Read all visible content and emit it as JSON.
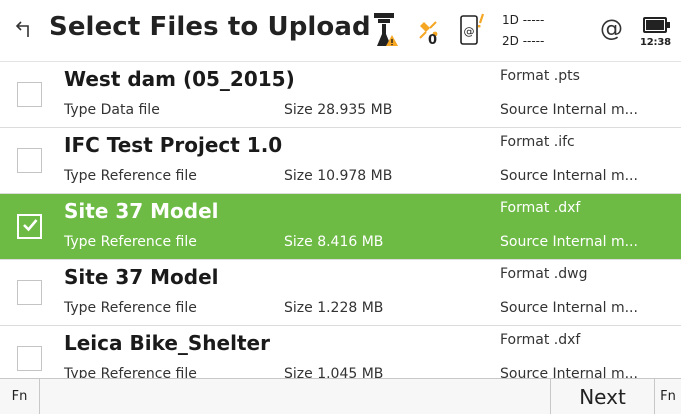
{
  "header": {
    "back_icon": "back-arrow-icon",
    "title": "Select Files to Upload",
    "satellite_count": "0",
    "quality": {
      "line1": "1D -----",
      "line2": "2D -----"
    },
    "internet_symbol": "@",
    "battery_time": "12:38",
    "colors": {
      "warning": "#f5a623",
      "battery": "#222222"
    }
  },
  "files": [
    {
      "name": "West dam (05_2015)",
      "type": "Type  Data file",
      "size": "Size  28.935 MB",
      "format": "Format  .pts",
      "source": "Source  Internal m...",
      "checked": false
    },
    {
      "name": "IFC Test Project 1.0",
      "type": "Type  Reference file",
      "size": "Size  10.978 MB",
      "format": "Format  .ifc",
      "source": "Source  Internal m...",
      "checked": false
    },
    {
      "name": "Site 37 Model",
      "type": "Type  Reference file",
      "size": "Size  8.416 MB",
      "format": "Format  .dxf",
      "source": "Source  Internal m...",
      "checked": true
    },
    {
      "name": "Site 37 Model",
      "type": "Type  Reference file",
      "size": "Size  1.228 MB",
      "format": "Format  .dwg",
      "source": "Source  Internal m...",
      "checked": false
    },
    {
      "name": "Leica Bike_Shelter",
      "type": "Type  Reference file",
      "size": "Size  1.045 MB",
      "format": "Format  .dxf",
      "source": "Source  Internal m...",
      "checked": false
    }
  ],
  "footer": {
    "fn_left": "Fn",
    "next_label": "Next",
    "fn_right": "Fn"
  },
  "colors": {
    "selected_row": "#6dbb45"
  }
}
